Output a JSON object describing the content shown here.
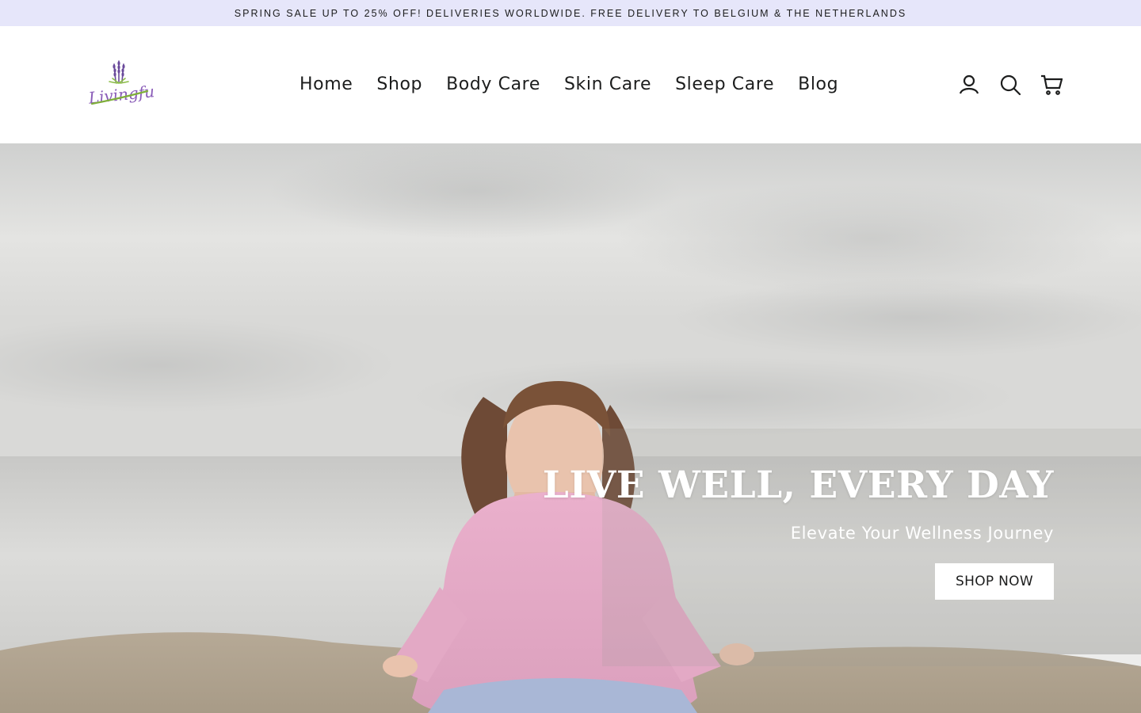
{
  "announcement": {
    "text": "SPRING SALE UP TO 25% OFF! DELIVERIES WORLDWIDE. FREE DELIVERY TO BELGIUM & THE NETHERLANDS",
    "background": "#e6e6fa"
  },
  "header": {
    "logo_text": "Livingful",
    "nav": [
      {
        "label": "Home"
      },
      {
        "label": "Shop"
      },
      {
        "label": "Body Care"
      },
      {
        "label": "Skin Care"
      },
      {
        "label": "Sleep Care"
      },
      {
        "label": "Blog"
      }
    ],
    "icons": [
      "user-icon",
      "search-icon",
      "cart-icon"
    ]
  },
  "hero": {
    "title": "LIVE WELL, EVERY DAY",
    "subtitle": "Elevate Your Wellness Journey",
    "cta_label": "SHOP NOW"
  },
  "colors": {
    "brand_purple": "#7b4fa8",
    "brand_green": "#7fae3a",
    "text_dark": "#1c1d1d"
  }
}
